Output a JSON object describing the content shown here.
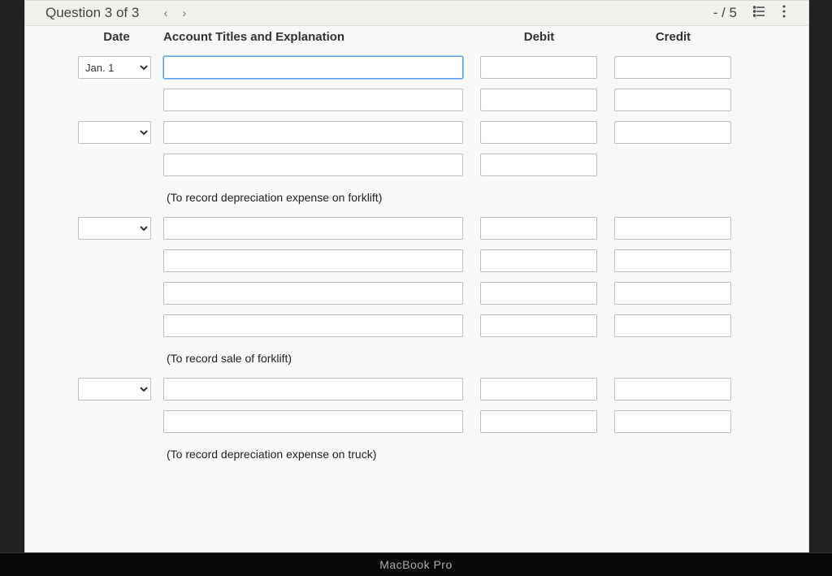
{
  "toolbar": {
    "question_label": "Question 3 of 3",
    "score": "- / 5"
  },
  "headers": {
    "date": "Date",
    "account": "Account Titles and Explanation",
    "debit": "Debit",
    "credit": "Credit"
  },
  "dates": {
    "r0": "Jan. 1",
    "r2": "",
    "r5": "",
    "r10": ""
  },
  "explanations": {
    "e1": "(To record depreciation expense on forklift)",
    "e2": "(To record sale of forklift)",
    "e3": "(To record depreciation expense on truck)"
  },
  "hardware": "MacBook Pro"
}
